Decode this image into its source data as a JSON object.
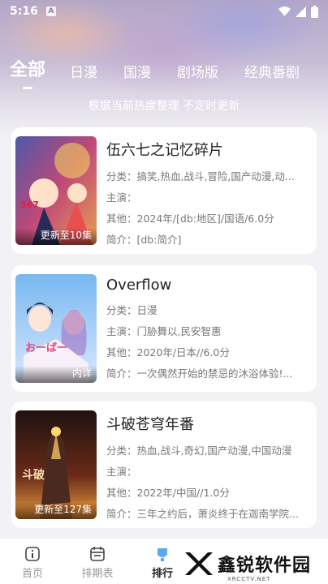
{
  "status": {
    "time": "5:16",
    "badge": "A"
  },
  "tabs": [
    {
      "label": "全部",
      "active": true
    },
    {
      "label": "日漫"
    },
    {
      "label": "国漫"
    },
    {
      "label": "剧场版"
    },
    {
      "label": "经典番剧"
    }
  ],
  "subtitle": "根据当前热度整理 不定时更新",
  "cards": [
    {
      "title": "伍六七之记忆碎片",
      "genre": "分类：搞笑,热血,战斗,冒险,国产动漫,动...",
      "cast": "主演：",
      "other": "其他：2024年/[db:地区]/国语/6.0分",
      "summary": "简介：[db:简介]",
      "badge": "更新至10集",
      "colors": [
        "#5a4a8a",
        "#d04a6a",
        "#f0b050"
      ]
    },
    {
      "title": "Overflow",
      "genre": "分类：日漫",
      "cast": "主演：门胁舞以,民安智惠",
      "other": "其他：2020年/日本//6.0分",
      "summary": "简介：一次偶然开始的禁忌的沐浴体验!...",
      "badge": "内详",
      "colors": [
        "#6aa8e8",
        "#f0c0d0",
        "#b080c8"
      ]
    },
    {
      "title": "斗破苍穹年番",
      "genre": "分类：热血,战斗,奇幻,国产动漫,中国动漫",
      "cast": "主演：",
      "other": "其他：2022年/中国//1.0分",
      "summary": "简介：三年之约后，萧炎终于在迦南学院...",
      "badge": "更新至127集",
      "colors": [
        "#2a1a1a",
        "#c86a2a",
        "#f0c060"
      ]
    }
  ],
  "nav": [
    {
      "label": "首页",
      "icon": "home-icon"
    },
    {
      "label": "排期表",
      "icon": "calendar-icon"
    },
    {
      "label": "排行",
      "icon": "ranking-icon",
      "active": true
    }
  ],
  "watermark": {
    "text": "鑫锐软件园",
    "url": "XRCCTV.NET"
  }
}
